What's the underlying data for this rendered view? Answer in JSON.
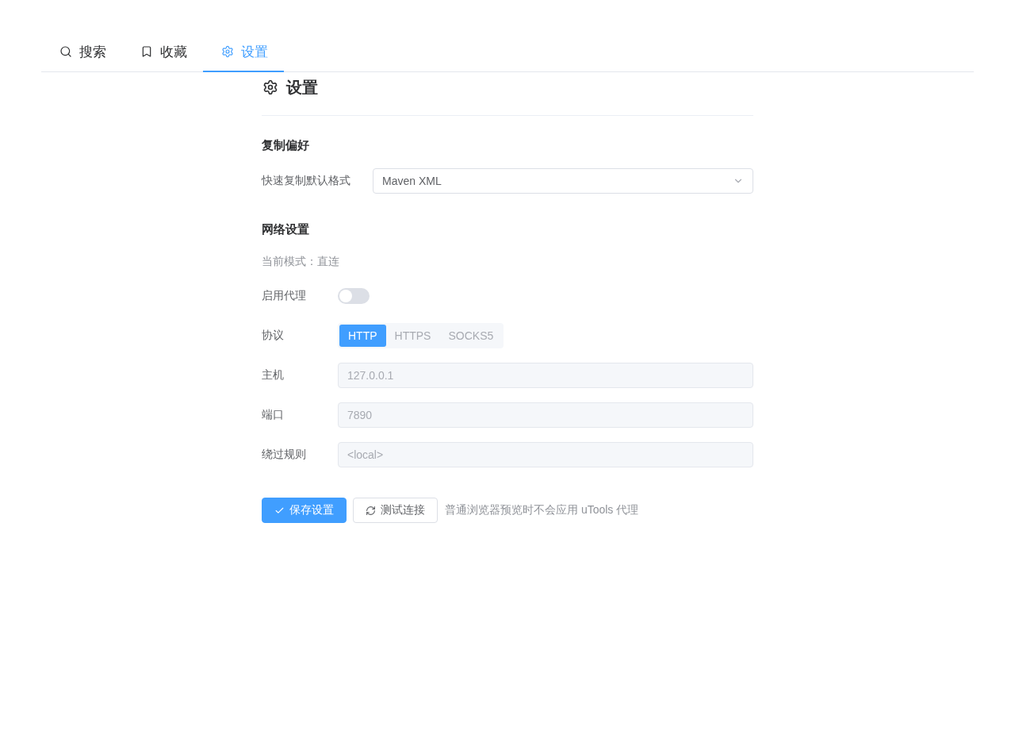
{
  "tabs": [
    {
      "label": "搜索",
      "selected": false
    },
    {
      "label": "收藏",
      "selected": false
    },
    {
      "label": "设置",
      "selected": true
    }
  ],
  "page_title": "设置",
  "copy_section": {
    "title": "复制偏好",
    "format_label": "快速复制默认格式",
    "format_select": {
      "value": "Maven XML"
    }
  },
  "network_section": {
    "title": "网络设置",
    "mode_text": "当前模式：直连",
    "proxy": {
      "label": "启用代理",
      "on": false
    },
    "protocol": {
      "label": "协议",
      "disabled": true,
      "options": [
        {
          "label": "HTTP",
          "selected": true
        },
        {
          "label": "HTTPS",
          "selected": false
        },
        {
          "label": "SOCKS5",
          "selected": false
        }
      ]
    },
    "fields": [
      {
        "label": "主机",
        "placeholder": "127.0.0.1",
        "disabled": true
      },
      {
        "label": "端口",
        "placeholder": "7890",
        "disabled": true
      },
      {
        "label": "绕过规则",
        "placeholder": "<local>",
        "disabled": true
      }
    ]
  },
  "actions": {
    "buttons": [
      {
        "label": "保存设置",
        "kind": "primary"
      },
      {
        "label": "测试连接",
        "kind": "default"
      }
    ],
    "note": "普通浏览器预览时不会应用 uTools 代理"
  }
}
